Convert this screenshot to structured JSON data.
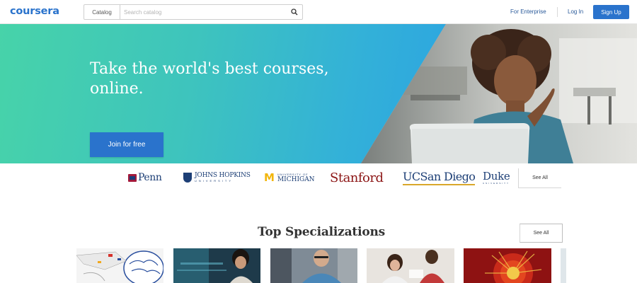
{
  "header": {
    "logo": "coursera",
    "catalog_label": "Catalog",
    "search_placeholder": "Search catalog",
    "enterprise_label": "For Enterprise",
    "login_label": "Log In",
    "signup_label": "Sign Up"
  },
  "hero": {
    "title_line1": "Take the world's best courses,",
    "title_line2": "online.",
    "cta_label": "Join for free"
  },
  "partners": {
    "penn": "Penn",
    "jhu_main": "JOHNS HOPKINS",
    "jhu_sub": "UNIVERSITY",
    "mich_sub": "UNIVERSITY OF",
    "mich_main": "MICHIGAN",
    "stanford": "Stanford",
    "ucsd": "UCSan Diego",
    "duke": "Duke",
    "duke_sub": "UNIVERSITY",
    "see_all_label": "See All"
  },
  "specializations": {
    "title": "Top Specializations",
    "see_all_label": "See All"
  },
  "colors": {
    "brand_blue": "#2a73cc",
    "hero_gradient_start": "#47d3a9",
    "hero_gradient_end": "#2da6e0",
    "stanford_red": "#8c1515",
    "michigan_maize": "#f2b60c"
  }
}
